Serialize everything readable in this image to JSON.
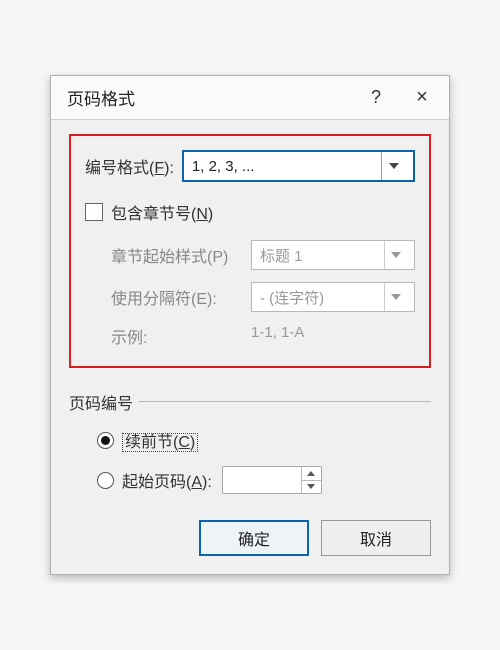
{
  "titlebar": {
    "title": "页码格式",
    "help": "?",
    "close": "×"
  },
  "format": {
    "label_pre": "编号格式(",
    "label_key": "F",
    "label_post": "):",
    "value": "1, 2, 3, ..."
  },
  "include_chapter": {
    "checked": false,
    "label_pre": "包含章节号(",
    "label_key": "N",
    "label_post": ")"
  },
  "chapter_start": {
    "label": "章节起始样式(P)",
    "value": "标题 1"
  },
  "separator": {
    "label": "使用分隔符(E):",
    "value": "-  (连字符)"
  },
  "example": {
    "label": "示例:",
    "value": "1-1, 1-A"
  },
  "page_numbering": {
    "legend": "页码编号",
    "continue": {
      "selected": true,
      "label_pre": "续前节(",
      "label_key": "C",
      "label_post": ")"
    },
    "start_at": {
      "selected": false,
      "label_pre": "起始页码(",
      "label_key": "A",
      "label_post": "):",
      "value": ""
    }
  },
  "buttons": {
    "ok": "确定",
    "cancel": "取消"
  }
}
